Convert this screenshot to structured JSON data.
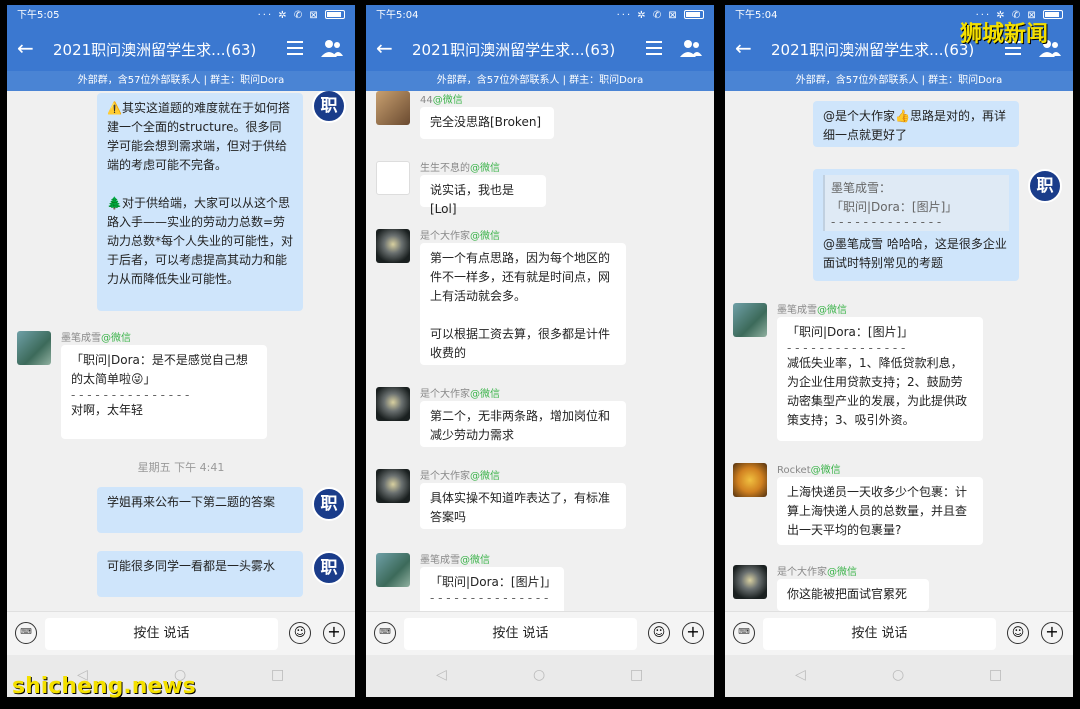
{
  "common": {
    "group_title": "2021职问澳洲留学生求...(63)",
    "group_subtitle": "外部群，含57位外部联系人 | 群主：职问Dora",
    "voice_label": "按住 说话",
    "zhi_label": "职",
    "wechat_tag": "@微信",
    "back_glyph": "←",
    "kb_glyph": "⌨",
    "emoji_glyph": "☺",
    "plus_glyph": "+",
    "nav_glyphs": [
      "◁",
      "○",
      "□"
    ],
    "status_icons": "··· ✲ ✆ ⊠"
  },
  "screen1": {
    "time": "下午5:05",
    "msg1": "⚠️其实这道题的难度就在于如何搭建一个全面的structure。很多同学可能会想到需求端，但对于供给端的考虑可能不完备。\n\n🌲对于供给端，大家可以从这个思路入手——实业的劳动力总数=劳动力总数*每个人失业的可能性，对于后者，可以考虑提高其动力和能力从而降低失业可能性。",
    "sender2": "墨笔成雪",
    "msg2_quote": "「职问|Dora：是不是感觉自己想的太简单啦😜」",
    "msg2_sep": "- - - - - - - - - - - - - - -",
    "msg2_text": "对啊，太年轻",
    "timestamp": "星期五  下午 4:41",
    "msg3": "学姐再来公布一下第二题的答案",
    "msg4": "可能很多同学一看都是一头雾水"
  },
  "screen2": {
    "time": "下午5:04",
    "sender1": "44",
    "msg1": "完全没思路[Broken]",
    "sender2": "生生不息的",
    "msg2": "说实话，我也是[Lol]",
    "sender3": "是个大作家",
    "msg3": "第一个有点思路，因为每个地区的件不一样多，还有就是时间点，网上有活动就会多。\n\n可以根据工资去算，很多都是计件收费的",
    "sender4": "是个大作家",
    "msg4": "第二个，无非两条路，增加岗位和减少劳动力需求",
    "sender5": "是个大作家",
    "msg5": "具体实操不知道咋表达了，有标准答案吗",
    "sender6": "墨笔成雪",
    "msg6_quote": "「职问|Dora：[图片]」",
    "msg6_sep": "- - - - - - - - - - - - - - -"
  },
  "screen3": {
    "time": "下午5:04",
    "msg1": "@是个大作家👍思路是对的，再详细一点就更好了",
    "msg2_quote_name": "墨笔成雪：",
    "msg2_quote_body": "「职问|Dora：[图片]」",
    "msg2_sep": "- - - - - - - - - - - - - -",
    "msg2_text": "@墨笔成雪 哈哈哈，这是很多企业面试时特别常见的考题",
    "sender3": "墨笔成雪",
    "msg3_quote": "「职问|Dora：[图片]」",
    "msg3_sep": "- - - - - - - - - - - - - - -",
    "msg3_text": "减低失业率，1、降低贷款利息，为企业住用贷款支持；2、鼓励劳动密集型产业的发展，为此提供政策支持；3、吸引外资。",
    "sender4": "Rocket",
    "msg4": "上海快递员一天收多少个包裹：计算上海快递人员的总数量，并且查出一天平均的包裹量?",
    "sender5": "是个大作家",
    "msg5": "你这能被把面试官累死"
  },
  "watermarks": {
    "top_right": "狮城新闻",
    "bottom_left": "shicheng.news"
  }
}
